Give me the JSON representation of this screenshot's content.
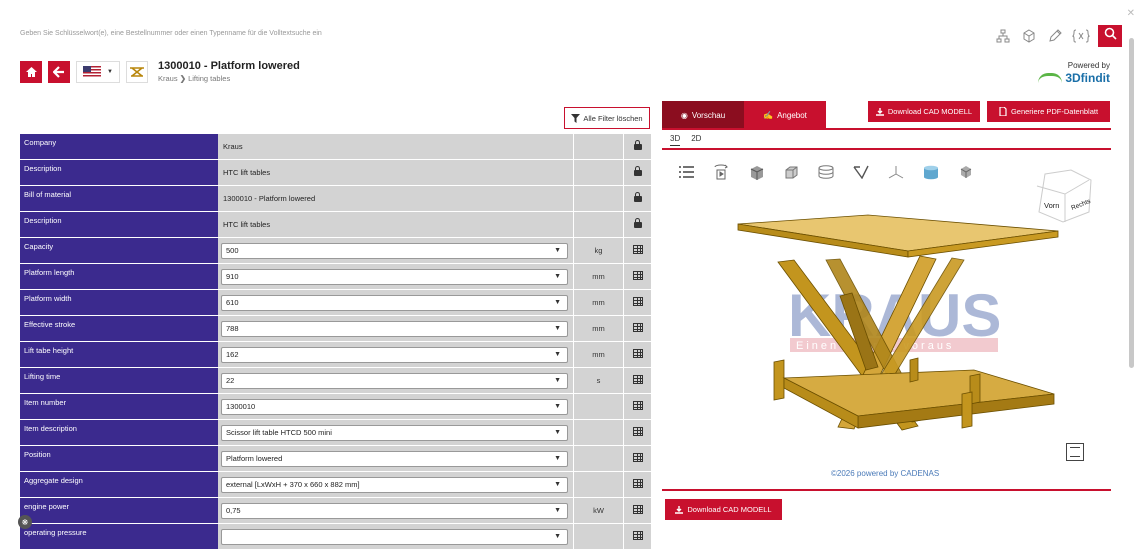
{
  "search": {
    "placeholder": "Geben Sie Schlüsselwort(e), eine Bestellnummer oder einen Typenname für die Volltextsuche ein"
  },
  "header": {
    "title": "1300010 - Platform lowered",
    "breadcrumb_root": "Kraus",
    "breadcrumb_sep": "❯",
    "breadcrumb_leaf": "Lifting tables",
    "powered_by": "Powered by",
    "brand": "3Dfindit"
  },
  "filters": {
    "clear_label": "Alle Filter löschen"
  },
  "properties": [
    {
      "label": "Company",
      "value": "Kraus",
      "unit": "",
      "kind": "static",
      "icon": "lock-icon"
    },
    {
      "label": "Description",
      "value": "HTC lift tables",
      "unit": "",
      "kind": "static",
      "icon": "lock-icon"
    },
    {
      "label": "Bill of material",
      "value": "1300010 - Platform lowered",
      "unit": "",
      "kind": "static",
      "icon": "lock-icon"
    },
    {
      "label": "Description",
      "value": "HTC lift tables",
      "unit": "",
      "kind": "static",
      "icon": "lock-icon"
    },
    {
      "label": "Capacity",
      "value": "500",
      "unit": "kg",
      "kind": "select",
      "icon": "table-icon"
    },
    {
      "label": "Platform length",
      "value": "910",
      "unit": "mm",
      "kind": "select",
      "icon": "table-icon"
    },
    {
      "label": "Platform width",
      "value": "610",
      "unit": "mm",
      "kind": "select",
      "icon": "table-icon"
    },
    {
      "label": "Effective stroke",
      "value": "788",
      "unit": "mm",
      "kind": "select",
      "icon": "table-icon"
    },
    {
      "label": "Lift tabe height",
      "value": "162",
      "unit": "mm",
      "kind": "select",
      "icon": "table-icon"
    },
    {
      "label": "Lifting time",
      "value": "22",
      "unit": "s",
      "kind": "select",
      "icon": "table-icon"
    },
    {
      "label": "Item number",
      "value": "1300010",
      "unit": "",
      "kind": "select",
      "icon": "table-icon"
    },
    {
      "label": "Item description",
      "value": "Scissor lift table HTCD 500 mini",
      "unit": "",
      "kind": "select",
      "icon": "table-icon"
    },
    {
      "label": "Position",
      "value": "Platform lowered",
      "unit": "",
      "kind": "select",
      "icon": "table-icon"
    },
    {
      "label": "Aggregate design",
      "value": "external [LxWxH + 370 x 660 x 882 mm]",
      "unit": "",
      "kind": "select",
      "icon": "table-icon"
    },
    {
      "label": "engine power",
      "value": "0,75",
      "unit": "kW",
      "kind": "select",
      "icon": "table-icon"
    },
    {
      "label": "operating pressure",
      "value": "",
      "unit": "",
      "kind": "select",
      "icon": "table-icon"
    }
  ],
  "panel": {
    "tab_preview": "Vorschau",
    "tab_offer": "Angebot",
    "download_cad": "Download CAD MODELL",
    "generate_pdf": "Generiere PDF-Datenblatt",
    "view_3d": "3D",
    "view_2d": "2D",
    "cube_front": "Vorn",
    "cube_right": "Rechts",
    "logo_text": "KRAUS",
    "logo_sub": "Einen Schritt voraus",
    "copyright": "©2026 powered by CADENAS",
    "download_cad_bottom": "Download CAD MODELL"
  },
  "colors": {
    "accent": "#c8102e",
    "accent_dark": "#8b0d1f",
    "label_bg": "#3b2a8e",
    "value_bg": "#d3d3d3",
    "model": "#d4a017"
  }
}
